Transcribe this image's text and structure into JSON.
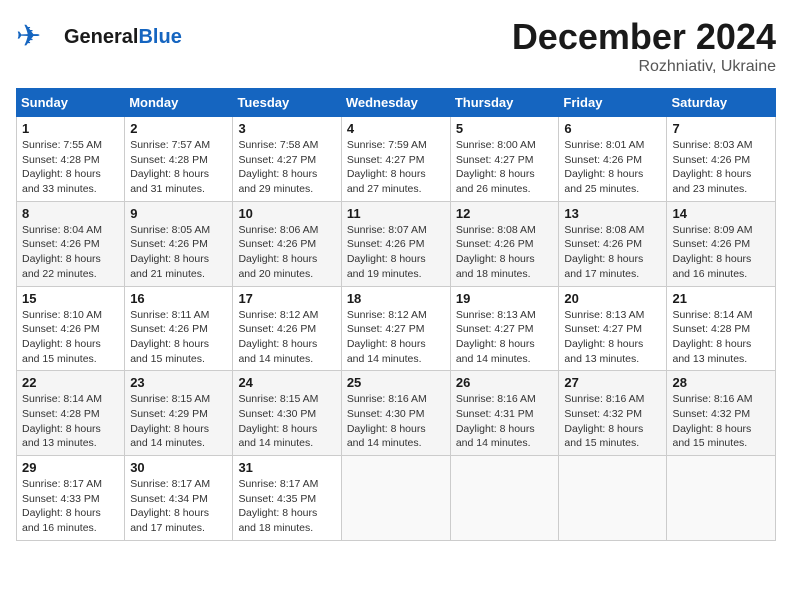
{
  "header": {
    "logo_general": "General",
    "logo_blue": "Blue",
    "month_title": "December 2024",
    "location": "Rozhniativ, Ukraine"
  },
  "weekdays": [
    "Sunday",
    "Monday",
    "Tuesday",
    "Wednesday",
    "Thursday",
    "Friday",
    "Saturday"
  ],
  "weeks": [
    [
      {
        "day": "1",
        "sunrise": "7:55 AM",
        "sunset": "4:28 PM",
        "daylight": "8 hours and 33 minutes."
      },
      {
        "day": "2",
        "sunrise": "7:57 AM",
        "sunset": "4:28 PM",
        "daylight": "8 hours and 31 minutes."
      },
      {
        "day": "3",
        "sunrise": "7:58 AM",
        "sunset": "4:27 PM",
        "daylight": "8 hours and 29 minutes."
      },
      {
        "day": "4",
        "sunrise": "7:59 AM",
        "sunset": "4:27 PM",
        "daylight": "8 hours and 27 minutes."
      },
      {
        "day": "5",
        "sunrise": "8:00 AM",
        "sunset": "4:27 PM",
        "daylight": "8 hours and 26 minutes."
      },
      {
        "day": "6",
        "sunrise": "8:01 AM",
        "sunset": "4:26 PM",
        "daylight": "8 hours and 25 minutes."
      },
      {
        "day": "7",
        "sunrise": "8:03 AM",
        "sunset": "4:26 PM",
        "daylight": "8 hours and 23 minutes."
      }
    ],
    [
      {
        "day": "8",
        "sunrise": "8:04 AM",
        "sunset": "4:26 PM",
        "daylight": "8 hours and 22 minutes."
      },
      {
        "day": "9",
        "sunrise": "8:05 AM",
        "sunset": "4:26 PM",
        "daylight": "8 hours and 21 minutes."
      },
      {
        "day": "10",
        "sunrise": "8:06 AM",
        "sunset": "4:26 PM",
        "daylight": "8 hours and 20 minutes."
      },
      {
        "day": "11",
        "sunrise": "8:07 AM",
        "sunset": "4:26 PM",
        "daylight": "8 hours and 19 minutes."
      },
      {
        "day": "12",
        "sunrise": "8:08 AM",
        "sunset": "4:26 PM",
        "daylight": "8 hours and 18 minutes."
      },
      {
        "day": "13",
        "sunrise": "8:08 AM",
        "sunset": "4:26 PM",
        "daylight": "8 hours and 17 minutes."
      },
      {
        "day": "14",
        "sunrise": "8:09 AM",
        "sunset": "4:26 PM",
        "daylight": "8 hours and 16 minutes."
      }
    ],
    [
      {
        "day": "15",
        "sunrise": "8:10 AM",
        "sunset": "4:26 PM",
        "daylight": "8 hours and 15 minutes."
      },
      {
        "day": "16",
        "sunrise": "8:11 AM",
        "sunset": "4:26 PM",
        "daylight": "8 hours and 15 minutes."
      },
      {
        "day": "17",
        "sunrise": "8:12 AM",
        "sunset": "4:26 PM",
        "daylight": "8 hours and 14 minutes."
      },
      {
        "day": "18",
        "sunrise": "8:12 AM",
        "sunset": "4:27 PM",
        "daylight": "8 hours and 14 minutes."
      },
      {
        "day": "19",
        "sunrise": "8:13 AM",
        "sunset": "4:27 PM",
        "daylight": "8 hours and 14 minutes."
      },
      {
        "day": "20",
        "sunrise": "8:13 AM",
        "sunset": "4:27 PM",
        "daylight": "8 hours and 13 minutes."
      },
      {
        "day": "21",
        "sunrise": "8:14 AM",
        "sunset": "4:28 PM",
        "daylight": "8 hours and 13 minutes."
      }
    ],
    [
      {
        "day": "22",
        "sunrise": "8:14 AM",
        "sunset": "4:28 PM",
        "daylight": "8 hours and 13 minutes."
      },
      {
        "day": "23",
        "sunrise": "8:15 AM",
        "sunset": "4:29 PM",
        "daylight": "8 hours and 14 minutes."
      },
      {
        "day": "24",
        "sunrise": "8:15 AM",
        "sunset": "4:30 PM",
        "daylight": "8 hours and 14 minutes."
      },
      {
        "day": "25",
        "sunrise": "8:16 AM",
        "sunset": "4:30 PM",
        "daylight": "8 hours and 14 minutes."
      },
      {
        "day": "26",
        "sunrise": "8:16 AM",
        "sunset": "4:31 PM",
        "daylight": "8 hours and 14 minutes."
      },
      {
        "day": "27",
        "sunrise": "8:16 AM",
        "sunset": "4:32 PM",
        "daylight": "8 hours and 15 minutes."
      },
      {
        "day": "28",
        "sunrise": "8:16 AM",
        "sunset": "4:32 PM",
        "daylight": "8 hours and 15 minutes."
      }
    ],
    [
      {
        "day": "29",
        "sunrise": "8:17 AM",
        "sunset": "4:33 PM",
        "daylight": "8 hours and 16 minutes."
      },
      {
        "day": "30",
        "sunrise": "8:17 AM",
        "sunset": "4:34 PM",
        "daylight": "8 hours and 17 minutes."
      },
      {
        "day": "31",
        "sunrise": "8:17 AM",
        "sunset": "4:35 PM",
        "daylight": "8 hours and 18 minutes."
      },
      null,
      null,
      null,
      null
    ]
  ]
}
